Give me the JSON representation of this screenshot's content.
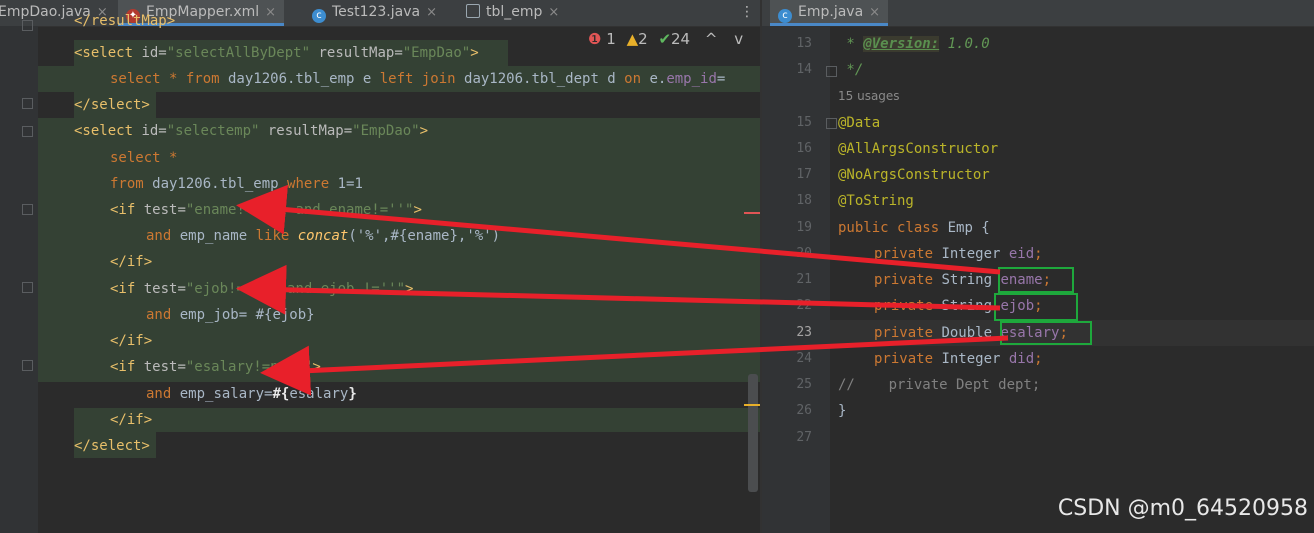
{
  "tabs_left": [
    {
      "label": "EmpDao.java",
      "close": "×",
      "icon": "java-icon"
    },
    {
      "label": "EmpMapper.xml",
      "close": "×",
      "icon": "mybatis-icon",
      "active": true
    },
    {
      "label": "Test123.java",
      "close": "×",
      "icon": "java-class-icon"
    },
    {
      "label": "tbl_emp",
      "close": "×",
      "icon": "table-icon"
    }
  ],
  "tabs_right": [
    {
      "label": "Emp.java",
      "close": "×",
      "icon": "java-class-icon",
      "active": true
    }
  ],
  "inspections": {
    "errors": "1",
    "warnings": "2",
    "ok": "24",
    "up": "^",
    "down": "v"
  },
  "xml_lines": {
    "l0": "</resultMap>",
    "l1_open": "<select",
    "l1_attr1": " id=",
    "l1_val1": "\"selectAllByDept\"",
    "l1_attr2": " resultMap=",
    "l1_val2": "\"EmpDao\"",
    "l1_close": ">",
    "l2_a": "select * ",
    "l2_from": "from",
    "l2_b": " day1206.tbl_emp e ",
    "l2_left": "left join",
    "l2_c": " day1206.tbl_dept d ",
    "l2_on": "on",
    "l2_d": " e.",
    "l2_e": "emp_id",
    "l2_f": "=",
    "l3": "</select>",
    "l4_val1": "\"selectemp\"",
    "l5": "select *",
    "l6_from": "from",
    "l6_b": " day1206.tbl_emp ",
    "l6_where": "where",
    "l6_c": " 1=1",
    "l7_open": "<if",
    "l7_attr": " test=",
    "l7_val": "\"ename!=null and ename!=''\"",
    "l7_close": ">",
    "l8_and": "and",
    "l8_b": " emp_name ",
    "l8_like": "like",
    "l8_concat": "concat",
    "l8_c": "('%',#{ename},'%')",
    "l9": "</if>",
    "l10_val": "\"ejob!=null and ejob !=''\"",
    "l11_and": "and",
    "l11_b": " emp_job= #{ejob}",
    "l12": "</if>",
    "l13_val": "\"esalary!=null\"",
    "l14_and": "and",
    "l14_b": " emp_salary=",
    "l14_c": "#{",
    "l14_d": "esalary",
    "l14_e": "}",
    "l15": "</if>",
    "l16": "</select>"
  },
  "java": {
    "line_numbers": [
      "13",
      "14",
      "15",
      "16",
      "17",
      "18",
      "19",
      "20",
      "21",
      "22",
      "23",
      "24",
      "25",
      "26",
      "27"
    ],
    "current_line": "23",
    "l13_star": " * ",
    "l13_tag": "@Version:",
    "l13_val": " 1.0.0",
    "l14": " */",
    "usages": "15 usages",
    "l15": "@Data",
    "l16": "@AllArgsConstructor",
    "l17": "@NoArgsConstructor",
    "l18": "@ToString",
    "l19_kw": "public class",
    "l19_b": " Emp {",
    "l20_kw": "private",
    "l20_type": " Integer ",
    "l20_f": "eid",
    "l21_kw": "private",
    "l21_type": " String ",
    "l21_f": "ename",
    "l22_kw": "private",
    "l22_type": " String ",
    "l22_f": "ejob",
    "l23_kw": "private",
    "l23_type": " Double ",
    "l23_f": "esalary",
    "l24_kw": "private",
    "l24_type": " Integer ",
    "l24_f": "did",
    "l25": "//    private Dept dept;",
    "l26": "}",
    "semi": ";"
  },
  "watermark": "CSDN @m0_64520958",
  "colors": {
    "arrow": "#e8202a",
    "box": "#1ea83c",
    "tab_active_underline": "#4a88c7"
  }
}
